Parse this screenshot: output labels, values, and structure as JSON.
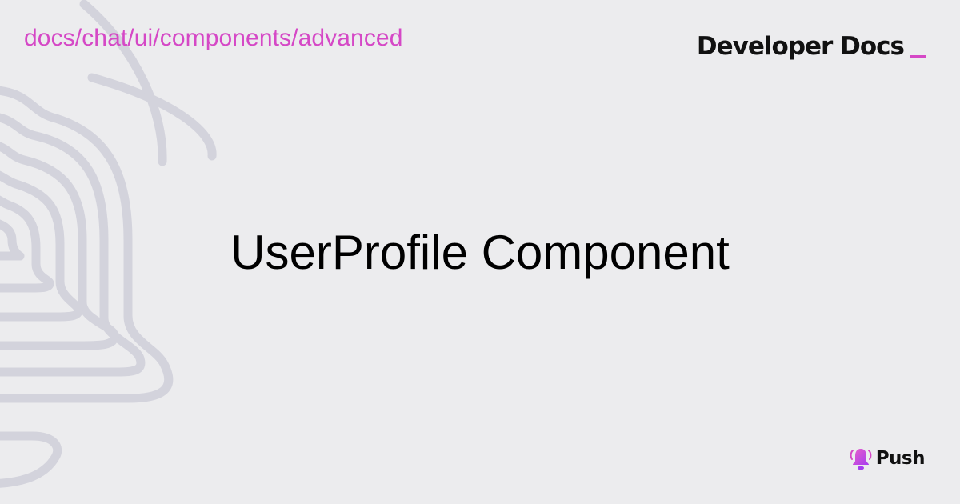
{
  "breadcrumb": {
    "path": "docs/chat/ui/components/advanced"
  },
  "brand": {
    "title": "Developer Docs",
    "accent_color": "#d548c6"
  },
  "page": {
    "title": "UserProfile Component"
  },
  "logo": {
    "name": "Push",
    "icon": "bell-icon"
  },
  "colors": {
    "background": "#ececee",
    "decoration": "#d3d3dc"
  }
}
